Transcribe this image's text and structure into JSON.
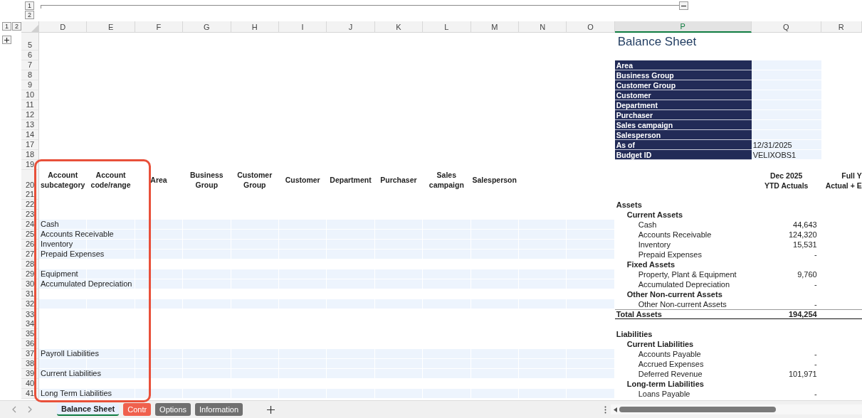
{
  "outline": {
    "top_levels": [
      "1",
      "2"
    ],
    "left_levels": [
      "1",
      "2"
    ]
  },
  "columns": [
    {
      "label": "D",
      "selected": false
    },
    {
      "label": "E",
      "selected": false
    },
    {
      "label": "F",
      "selected": false
    },
    {
      "label": "G",
      "selected": false
    },
    {
      "label": "H",
      "selected": false
    },
    {
      "label": "I",
      "selected": false
    },
    {
      "label": "J",
      "selected": false
    },
    {
      "label": "K",
      "selected": false
    },
    {
      "label": "L",
      "selected": false
    },
    {
      "label": "M",
      "selected": false
    },
    {
      "label": "N",
      "selected": false
    },
    {
      "label": "O",
      "selected": false
    },
    {
      "label": "P",
      "selected": true
    },
    {
      "label": "Q",
      "selected": false
    },
    {
      "label": "R",
      "selected": false
    }
  ],
  "rows": [
    {
      "number": "5",
      "shaded": false,
      "collapsed_group": true,
      "title": "Balance Sheet"
    },
    {
      "number": "6",
      "shaded": false
    },
    {
      "number": "7",
      "shaded": false,
      "filter": {
        "label": "Area"
      }
    },
    {
      "number": "8",
      "shaded": false,
      "filter": {
        "label": "Business Group"
      }
    },
    {
      "number": "9",
      "shaded": false,
      "filter": {
        "label": "Customer Group"
      }
    },
    {
      "number": "10",
      "shaded": false,
      "filter": {
        "label": "Customer"
      }
    },
    {
      "number": "11",
      "shaded": false,
      "filter": {
        "label": "Department"
      }
    },
    {
      "number": "12",
      "shaded": false,
      "filter": {
        "label": "Purchaser"
      }
    },
    {
      "number": "13",
      "shaded": false,
      "filter": {
        "label": "Sales campaign"
      }
    },
    {
      "number": "14",
      "shaded": false,
      "filter": {
        "label": "Salesperson"
      }
    },
    {
      "number": "17",
      "shaded": false,
      "filter": {
        "label": "As of",
        "value": "12/31/2025"
      }
    },
    {
      "number": "18",
      "shaded": false,
      "filter": {
        "label": "Budget ID",
        "value": "VELIXOBS1"
      }
    },
    {
      "number": "19",
      "shaded": false
    },
    {
      "number": "20",
      "shaded": false,
      "headers": [
        [
          "Account",
          "subcategory"
        ],
        [
          "Account",
          "code/range"
        ],
        [
          "Area"
        ],
        [
          "Business",
          "Group"
        ],
        [
          "Customer",
          "Group"
        ],
        [
          "Customer"
        ],
        [
          "Department"
        ],
        [
          "Purchaser"
        ],
        [
          "Sales",
          "campaign"
        ],
        [
          "Salesperson"
        ]
      ],
      "period_headers": [
        [
          "Dec 2025",
          "YTD Actuals"
        ],
        [
          "Full Y",
          "Actual + E"
        ]
      ]
    },
    {
      "number": "21",
      "shaded": false
    },
    {
      "number": "22",
      "shaded": false,
      "line": {
        "kind": "section",
        "label": "Assets"
      }
    },
    {
      "number": "23",
      "shaded": false,
      "line": {
        "kind": "group",
        "label": "Current Assets"
      }
    },
    {
      "number": "24",
      "shaded": true,
      "account": "Cash",
      "line": {
        "kind": "item",
        "label": "Cash",
        "value": "44,643"
      }
    },
    {
      "number": "25",
      "shaded": true,
      "account": "Accounts Receivable",
      "line": {
        "kind": "item",
        "label": "Accounts Receivable",
        "value": "124,320"
      }
    },
    {
      "number": "26",
      "shaded": true,
      "account": "Inventory",
      "line": {
        "kind": "item",
        "label": "Inventory",
        "value": "15,531"
      }
    },
    {
      "number": "27",
      "shaded": true,
      "account": "Prepaid Expenses",
      "line": {
        "kind": "item",
        "label": "Prepaid Expenses",
        "value": "-"
      }
    },
    {
      "number": "28",
      "shaded": false,
      "line": {
        "kind": "group",
        "label": "Fixed Assets"
      }
    },
    {
      "number": "29",
      "shaded": true,
      "account": "Equipment",
      "line": {
        "kind": "item",
        "label": "Property, Plant & Equipment",
        "value": "9,760"
      }
    },
    {
      "number": "30",
      "shaded": true,
      "account": "Accumulated Depreciation",
      "line": {
        "kind": "item",
        "label": "Accumulated Depreciation",
        "value": "-"
      }
    },
    {
      "number": "31",
      "shaded": false,
      "line": {
        "kind": "group",
        "label": "Other Non-current Assets"
      }
    },
    {
      "number": "32",
      "shaded": true,
      "line": {
        "kind": "item",
        "label": "Other Non-current Assets",
        "value": "-"
      }
    },
    {
      "number": "33",
      "shaded": false,
      "line": {
        "kind": "total",
        "label": "Total Assets",
        "value": "194,254"
      }
    },
    {
      "number": "34",
      "shaded": false
    },
    {
      "number": "35",
      "shaded": false,
      "line": {
        "kind": "section",
        "label": "Liabilities"
      }
    },
    {
      "number": "36",
      "shaded": false,
      "line": {
        "kind": "group",
        "label": "Current Liabilities"
      }
    },
    {
      "number": "37",
      "shaded": true,
      "account": "Payroll Liabilities",
      "line": {
        "kind": "item",
        "label": "Accounts Payable",
        "value": "-"
      }
    },
    {
      "number": "38",
      "shaded": true,
      "line": {
        "kind": "item",
        "label": "Accrued Expenses",
        "value": "-"
      }
    },
    {
      "number": "39",
      "shaded": true,
      "account": "Current Liabilities",
      "line": {
        "kind": "item",
        "label": "Deferred Revenue",
        "value": "101,971"
      }
    },
    {
      "number": "40",
      "shaded": false,
      "line": {
        "kind": "group",
        "label": "Long-term Liabilities"
      }
    },
    {
      "number": "41",
      "shaded": true,
      "account": "Long Term Liabilities",
      "line": {
        "kind": "item",
        "label": "Loans Payable",
        "value": "-"
      }
    }
  ],
  "sheet_tabs": [
    {
      "label": "Balance Sheet",
      "selected": true
    },
    {
      "label": "Contr",
      "selected": false,
      "color": "#f0604d"
    },
    {
      "label": "Options",
      "selected": false,
      "color": "#707070"
    },
    {
      "label": "Information",
      "selected": false,
      "color": "#707070"
    }
  ]
}
